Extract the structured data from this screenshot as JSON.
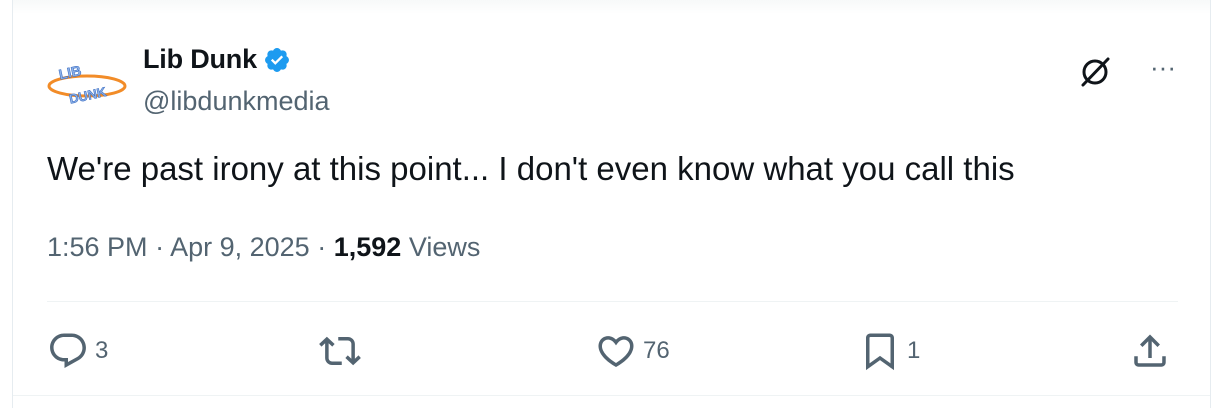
{
  "author": {
    "display_name": "Lib Dunk",
    "handle": "@libdunkmedia",
    "verified": true,
    "avatar_logo_text_top": "LIB",
    "avatar_logo_text_bottom": "DUNK",
    "verified_color": "#1d9bf0"
  },
  "tweet": {
    "text": "We're past irony at this point... I don't even know what you call this",
    "time": "1:56 PM",
    "separator": "·",
    "date": "Apr 9, 2025",
    "views_count": "1,592",
    "views_label": "Views"
  },
  "header_actions": {
    "grok_icon": "grok-slash-circle-icon",
    "more_label": "···"
  },
  "actions": {
    "reply": {
      "icon": "reply-icon",
      "count": "3"
    },
    "retweet": {
      "icon": "retweet-icon",
      "count": ""
    },
    "like": {
      "icon": "heart-icon",
      "count": "76"
    },
    "bookmark": {
      "icon": "bookmark-icon",
      "count": "1"
    },
    "share": {
      "icon": "share-icon",
      "count": ""
    }
  },
  "colors": {
    "text_primary": "#0f1419",
    "text_secondary": "#536471",
    "divider": "#eff3f4"
  }
}
